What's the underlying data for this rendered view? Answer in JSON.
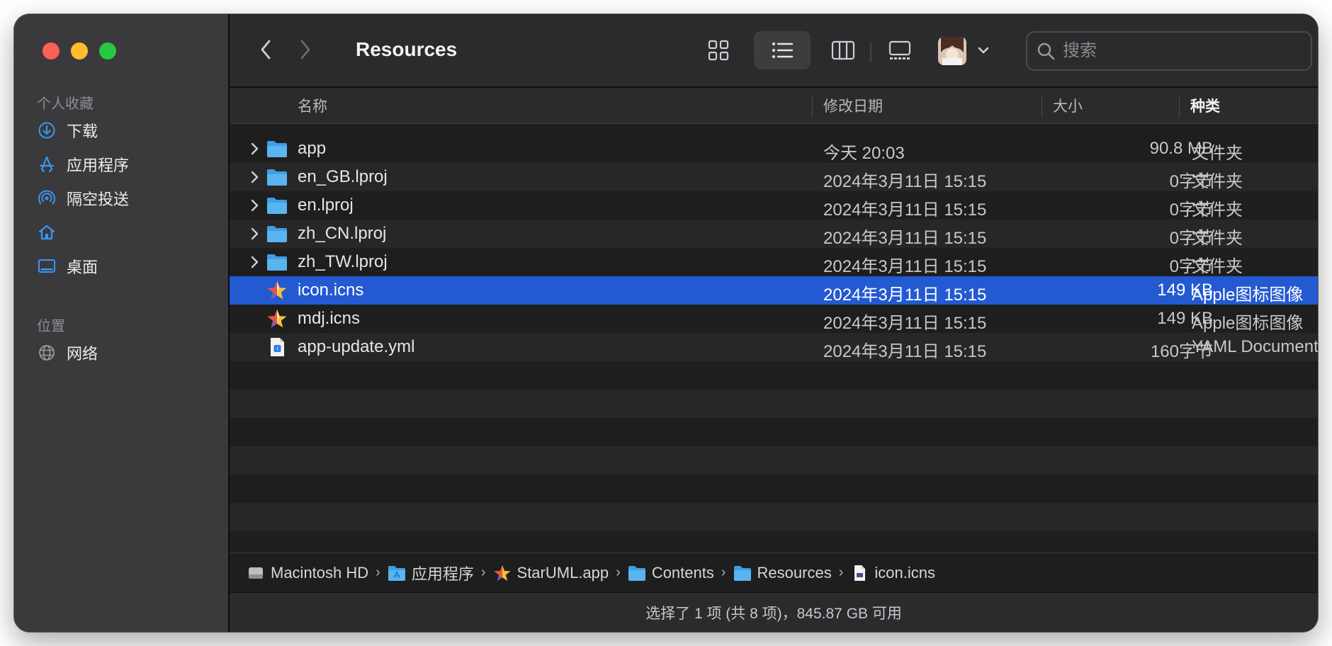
{
  "window": {
    "title": "Resources"
  },
  "sidebar": {
    "favorites_header": "个人收藏",
    "favorites": [
      {
        "label": "下载",
        "icon": "download-icon"
      },
      {
        "label": "应用程序",
        "icon": "applications-icon"
      },
      {
        "label": "隔空投送",
        "icon": "airdrop-icon"
      },
      {
        "label": "",
        "icon": "home-icon"
      },
      {
        "label": "桌面",
        "icon": "desktop-icon"
      }
    ],
    "locations_header": "位置",
    "locations": [
      {
        "label": "网络",
        "icon": "network-icon"
      }
    ]
  },
  "toolbar": {
    "view_modes": [
      "icon-view",
      "list-view",
      "column-view",
      "gallery-view"
    ],
    "active_view": "list-view"
  },
  "search": {
    "placeholder": "搜索",
    "value": ""
  },
  "columns": {
    "name": "名称",
    "date": "修改日期",
    "size": "大小",
    "kind": "种类"
  },
  "files": [
    {
      "name": "app",
      "date": "今天 20:03",
      "size": "90.8 MB",
      "kind": "文件夹",
      "type": "folder"
    },
    {
      "name": "en_GB.lproj",
      "date": "2024年3月11日 15:15",
      "size": "0字节",
      "kind": "文件夹",
      "type": "folder"
    },
    {
      "name": "en.lproj",
      "date": "2024年3月11日 15:15",
      "size": "0字节",
      "kind": "文件夹",
      "type": "folder"
    },
    {
      "name": "zh_CN.lproj",
      "date": "2024年3月11日 15:15",
      "size": "0字节",
      "kind": "文件夹",
      "type": "folder"
    },
    {
      "name": "zh_TW.lproj",
      "date": "2024年3月11日 15:15",
      "size": "0字节",
      "kind": "文件夹",
      "type": "folder"
    },
    {
      "name": "icon.icns",
      "date": "2024年3月11日 15:15",
      "size": "149 KB",
      "kind": "Apple图标图像",
      "type": "icns",
      "selected": true
    },
    {
      "name": "mdj.icns",
      "date": "2024年3月11日 15:15",
      "size": "149 KB",
      "kind": "Apple图标图像",
      "type": "icns"
    },
    {
      "name": "app-update.yml",
      "date": "2024年3月11日 15:15",
      "size": "160字节",
      "kind": "YAML Document",
      "type": "yml"
    }
  ],
  "pathbar": [
    {
      "label": "Macintosh HD",
      "icon": "hard-drive-icon"
    },
    {
      "label": "应用程序",
      "icon": "folder-icon"
    },
    {
      "label": "StarUML.app",
      "icon": "staruml-icon"
    },
    {
      "label": "Contents",
      "icon": "folder-icon"
    },
    {
      "label": "Resources",
      "icon": "folder-icon"
    },
    {
      "label": "icon.icns",
      "icon": "file-icon"
    }
  ],
  "status": "选择了 1 项 (共 8 项)，845.87 GB 可用",
  "colors": {
    "selection": "#2359d1",
    "folder": "#5ab4f0",
    "accent": "#0a84ff"
  }
}
